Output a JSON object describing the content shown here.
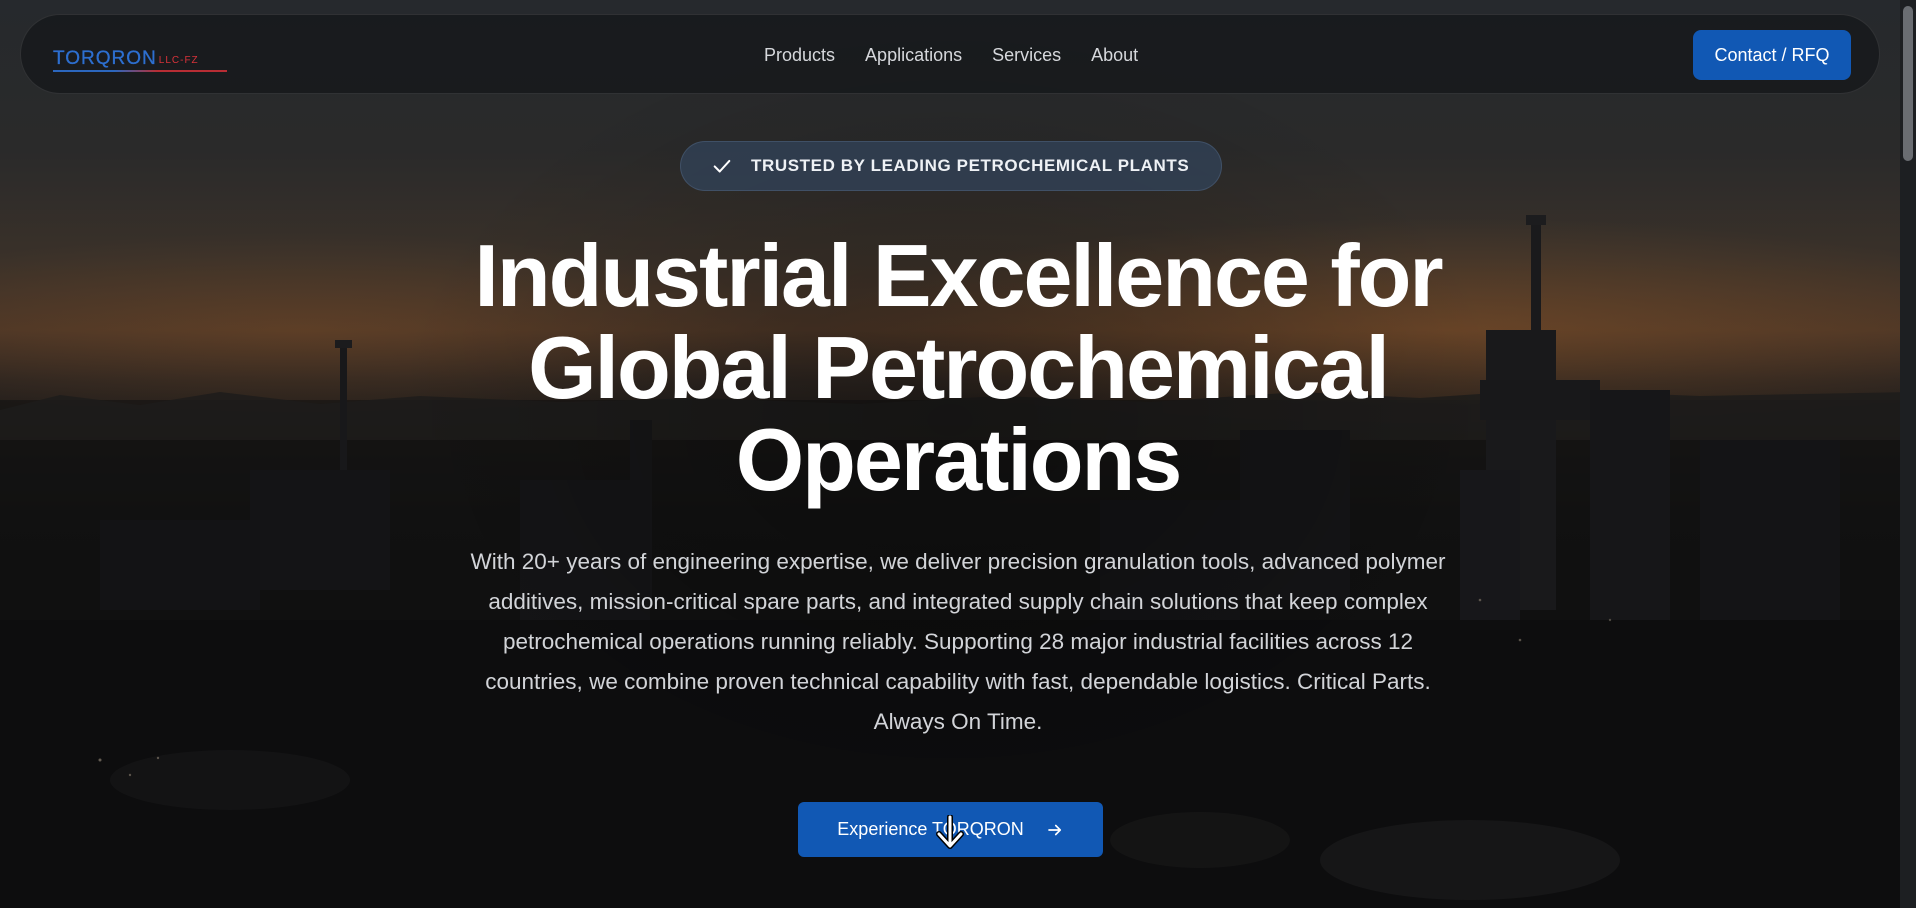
{
  "colors": {
    "primary": "#1158b4",
    "logo_blue": "#2d6fd0",
    "logo_red": "#d6323a",
    "background": "#0b0c0e"
  },
  "navbar": {
    "logo_main": "TORQRON",
    "logo_sub": "LLC-FZ",
    "links": [
      {
        "label": "Products"
      },
      {
        "label": "Applications"
      },
      {
        "label": "Services"
      },
      {
        "label": "About"
      }
    ],
    "contact_label": "Contact / RFQ"
  },
  "hero": {
    "badge_icon": "check-icon",
    "badge_text": "TRUSTED BY LEADING PETROCHEMICAL PLANTS",
    "headline_line1": "Industrial Excellence for",
    "headline_line2": "Global Petrochemical",
    "headline_line3": "Operations",
    "description": "With 20+ years of engineering expertise, we deliver precision granulation tools, advanced polymer additives, mission-critical spare parts, and integrated supply chain solutions that keep complex petrochemical operations running reliably. Supporting 28 major industrial facilities across 12 countries, we combine proven technical capability with fast, dependable logistics. Critical Parts. Always On Time.",
    "cta_label": "Experience TORQRON",
    "cta_icon": "arrow-right-icon",
    "scroll_icon": "arrow-down-icon"
  }
}
